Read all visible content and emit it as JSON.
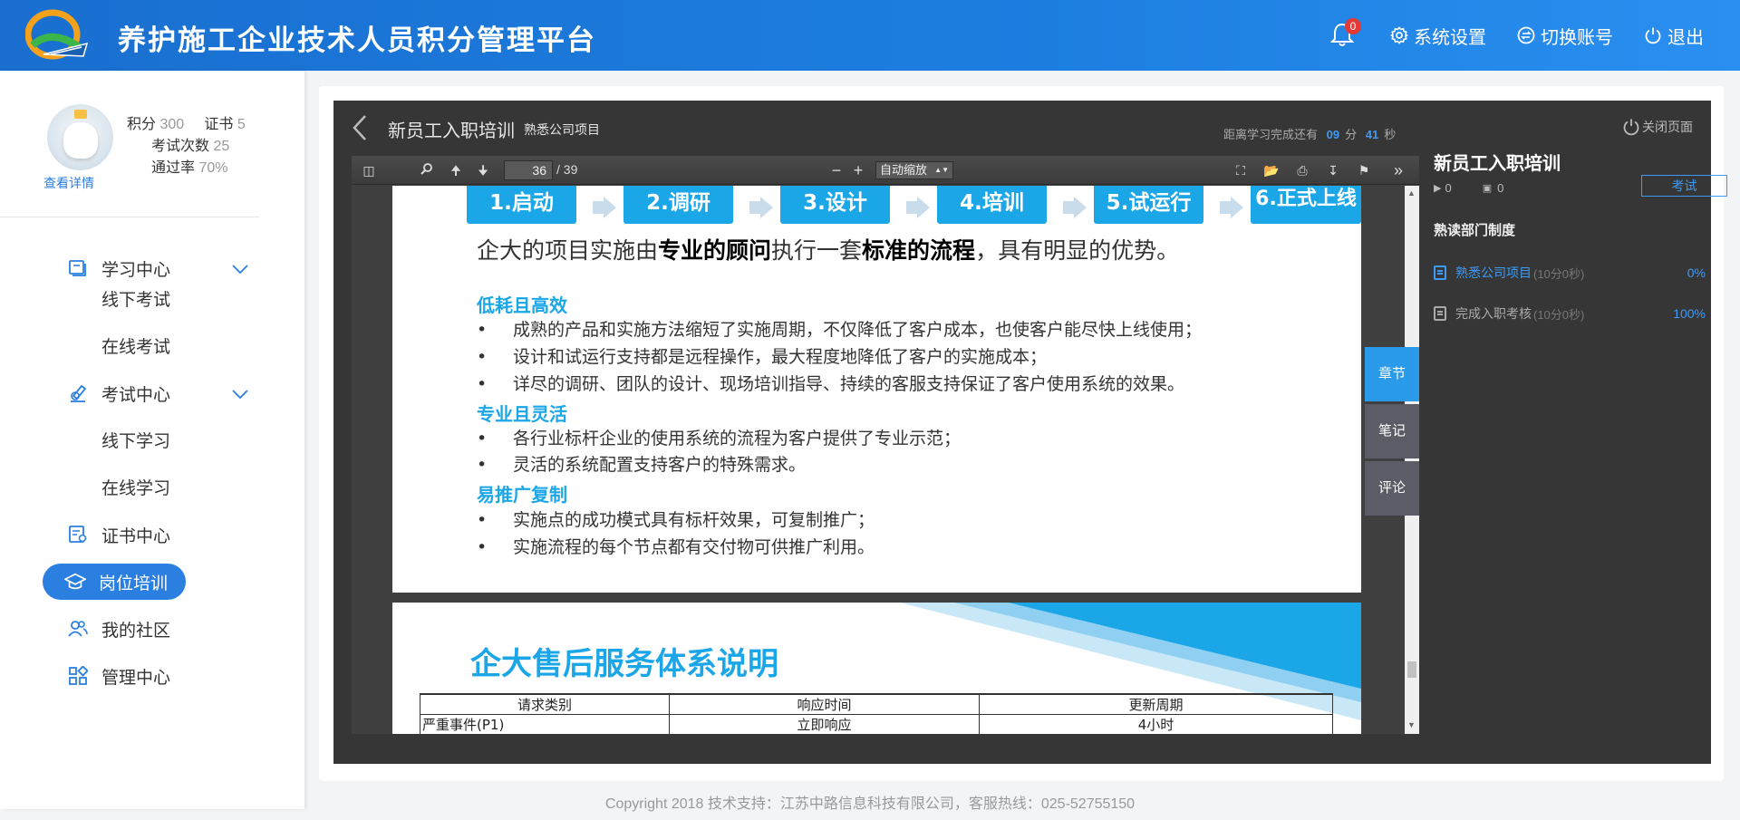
{
  "header": {
    "app_title": "养护施工企业技术人员积分管理平台",
    "notification_count": "0",
    "settings_label": "系统设置",
    "switch_account_label": "切换账号",
    "logout_label": "退出",
    "bg_color": "#1c7fe0"
  },
  "profile": {
    "view_detail": "查看详情",
    "points_label": "积分",
    "points_value": "300",
    "certs_label": "证书",
    "certs_value": "5",
    "exam_count_label": "考试次数",
    "exam_count_value": "25",
    "pass_rate_label": "通过率",
    "pass_rate_value": "70%"
  },
  "nav": {
    "study_center": "学习中心",
    "offline_exam": "线下考试",
    "online_exam": "在线考试",
    "exam_center": "考试中心",
    "offline_study": "线下学习",
    "online_study": "在线学习",
    "cert_center": "证书中心",
    "job_training": "岗位培训",
    "community": "我的社区",
    "admin_center": "管理中心",
    "active_color": "#2a7fe0"
  },
  "course": {
    "title": "新员工入职培训",
    "subtitle": "熟悉公司项目",
    "countdown_prefix": "距离学习完成还有",
    "minutes": "09",
    "minutes_unit": "分",
    "seconds": "41",
    "seconds_unit": "秒"
  },
  "pdf_viewer": {
    "current_page": "36",
    "total_pages": "/ 39",
    "zoom": "自动缩放",
    "page1": {
      "steps": [
        "1.启动",
        "2.调研",
        "3.设计",
        "4.培训",
        "5.试运行",
        "6.正式上线"
      ],
      "lead_plain1": "企大的项目实施由",
      "lead_bold1": "专业的顾问",
      "lead_plain2": "执行一套",
      "lead_bold2": "标准的流程",
      "lead_plain3": "，具有明显的优势。",
      "sections": [
        {
          "heading": "低耗且高效",
          "bullets": [
            "成熟的产品和实施方法缩短了实施周期，不仅降低了客户成本，也使客户能尽快上线使用；",
            "设计和试运行支持都是远程操作，最大程度地降低了客户的实施成本；",
            "详尽的调研、团队的设计、现场培训指导、持续的客服支持保证了客户使用系统的效果。"
          ]
        },
        {
          "heading": "专业且灵活",
          "bullets": [
            "各行业标杆企业的使用系统的流程为客户提供了专业示范；",
            "灵活的系统配置支持客户的特殊需求。"
          ]
        },
        {
          "heading": "易推广复制",
          "bullets": [
            "实施点的成功模式具有标杆效果，可复制推广；",
            "实施流程的每个节点都有交付物可供推广利用。"
          ]
        }
      ],
      "bullet_char": "•"
    },
    "page2": {
      "title": "企大售后服务体系说明",
      "table_headers": [
        "请求类别",
        "响应时间",
        "更新周期"
      ],
      "table_rows": [
        [
          "严重事件(P1)",
          "立即响应",
          "4小时"
        ]
      ]
    }
  },
  "side_tabs": {
    "chapter": "章节",
    "notes": "笔记",
    "comments": "评论"
  },
  "right_panel": {
    "close_page": "关闭页面",
    "title": "新员工入职培训",
    "plays": "0",
    "comments": "0",
    "exam_button": "考试",
    "section_title": "熟读部门制度",
    "items": [
      {
        "name": "熟悉公司项目",
        "duration": "(10分0秒)",
        "percent": "0%"
      },
      {
        "name": "完成入职考核",
        "duration": "(10分0秒)",
        "percent": "100%"
      }
    ]
  },
  "footer": {
    "text": "Copyright 2018 技术支持：江苏中路信息科技有限公司，客服热线：025-52755150"
  }
}
